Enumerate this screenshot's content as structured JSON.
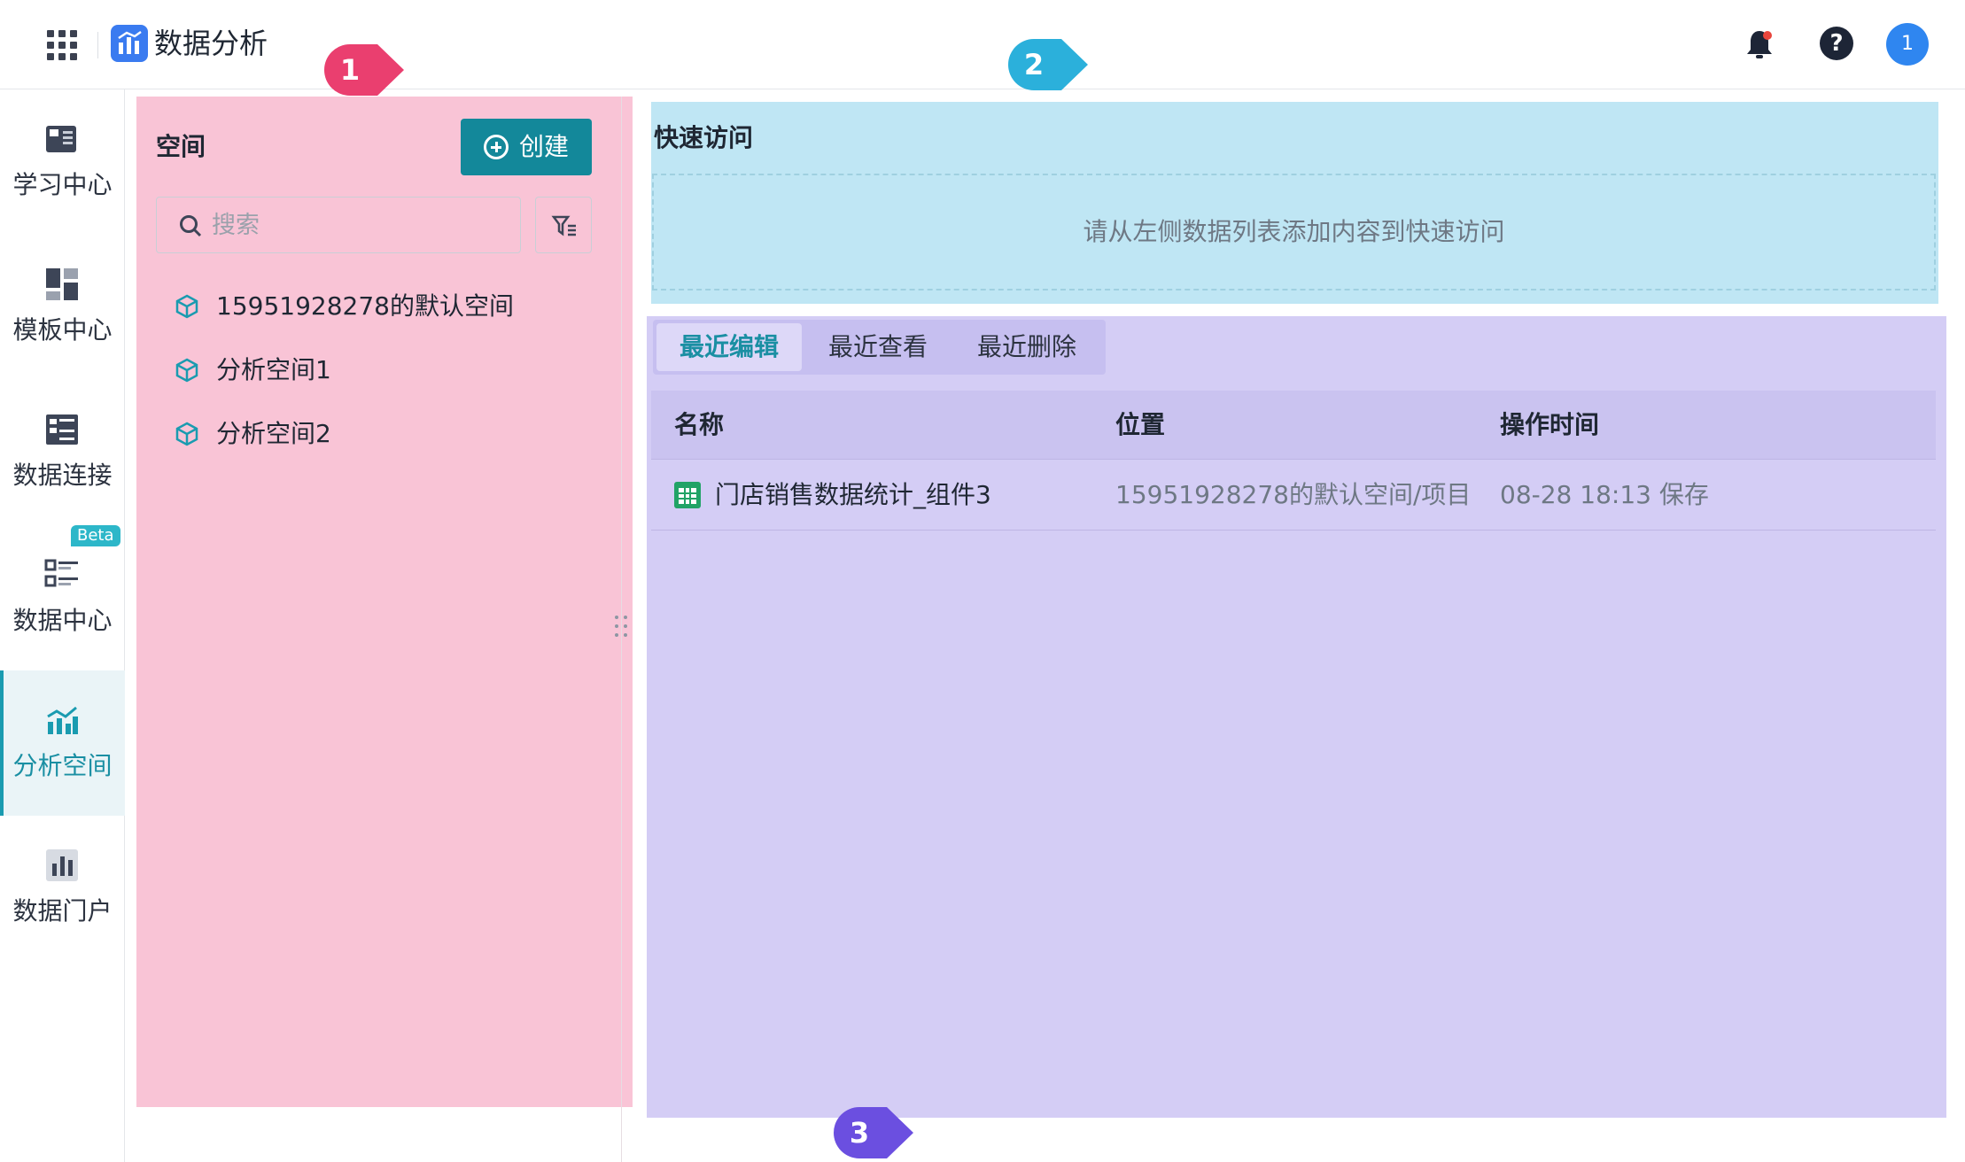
{
  "header": {
    "app_title": "数据分析",
    "avatar_text": "1",
    "help_text": "?"
  },
  "nav": {
    "items": [
      {
        "label": "学习中心",
        "icon": "book-icon"
      },
      {
        "label": "模板中心",
        "icon": "template-icon"
      },
      {
        "label": "数据连接",
        "icon": "connection-icon"
      },
      {
        "label": "数据中心",
        "icon": "data-center-icon",
        "badge": "Beta"
      },
      {
        "label": "分析空间",
        "icon": "analysis-space-icon",
        "active": true
      },
      {
        "label": "数据门户",
        "icon": "portal-chart-icon"
      }
    ]
  },
  "spaces_panel": {
    "title": "空间",
    "create_label": "创建",
    "search_placeholder": "搜索",
    "items": [
      {
        "label": "15951928278的默认空间"
      },
      {
        "label": "分析空间1"
      },
      {
        "label": "分析空间2"
      }
    ]
  },
  "quick_access": {
    "title": "快速访问",
    "empty_text": "请从左侧数据列表添加内容到快速访问"
  },
  "recent": {
    "tabs": [
      {
        "label": "最近编辑",
        "active": true
      },
      {
        "label": "最近查看"
      },
      {
        "label": "最近删除"
      }
    ],
    "columns": [
      "名称",
      "位置",
      "操作时间"
    ],
    "rows": [
      {
        "name": "门店销售数据统计_组件3",
        "location": "15951928278的默认空间/项目",
        "time": "08-28 18:13 保存"
      }
    ]
  },
  "markers": [
    {
      "label": "1",
      "color": "#ea3f6f"
    },
    {
      "label": "2",
      "color": "#2bb0db"
    },
    {
      "label": "3",
      "color": "#6b4fe0"
    }
  ],
  "colors": {
    "accent": "#13889a",
    "panel1": "#f9c4d6",
    "panel2": "#bfe6f4",
    "panel3": "#d4cdf5"
  }
}
